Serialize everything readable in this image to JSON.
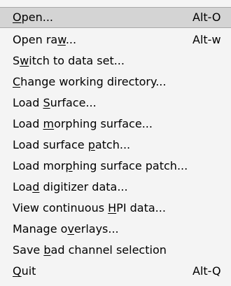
{
  "menu": {
    "items": [
      {
        "pre": "",
        "mn": "O",
        "post": "pen...",
        "shortcut": "Alt-O",
        "highlighted": true
      },
      {
        "pre": "Open ra",
        "mn": "w",
        "post": "...",
        "shortcut": "Alt-w"
      },
      {
        "pre": "S",
        "mn": "w",
        "post": "itch to data set...",
        "shortcut": ""
      },
      {
        "pre": "",
        "mn": "C",
        "post": "hange working directory...",
        "shortcut": ""
      },
      {
        "pre": "Load ",
        "mn": "S",
        "post": "urface...",
        "shortcut": ""
      },
      {
        "pre": "Load ",
        "mn": "m",
        "post": "orphing surface...",
        "shortcut": ""
      },
      {
        "pre": "Load surface ",
        "mn": "p",
        "post": "atch...",
        "shortcut": ""
      },
      {
        "pre": "Load mor",
        "mn": "p",
        "post": "hing surface patch...",
        "shortcut": ""
      },
      {
        "pre": "Loa",
        "mn": "d",
        "post": " digitizer data...",
        "shortcut": ""
      },
      {
        "pre": "View continuous ",
        "mn": "H",
        "post": "PI data...",
        "shortcut": ""
      },
      {
        "pre": "Manage o",
        "mn": "v",
        "post": "erlays...",
        "shortcut": ""
      },
      {
        "pre": "Save ",
        "mn": "b",
        "post": "ad channel selection",
        "shortcut": ""
      },
      {
        "pre": "",
        "mn": "Q",
        "post": "uit",
        "shortcut": "Alt-Q"
      }
    ]
  }
}
